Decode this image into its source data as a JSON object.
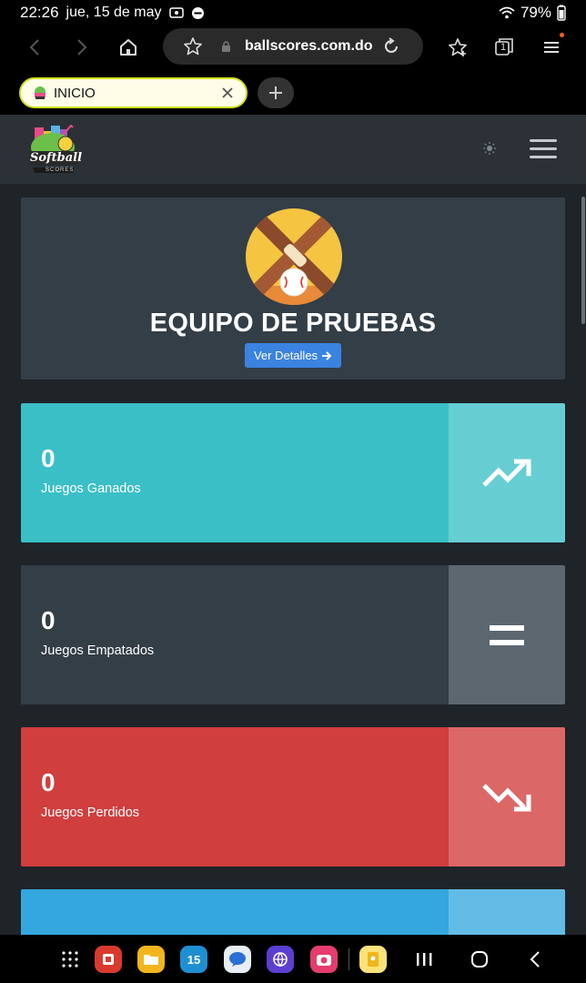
{
  "status_bar": {
    "time": "22:26",
    "date": "jue, 15 de may",
    "battery": "79%",
    "icons": [
      "screen-record-icon",
      "dnd-icon",
      "wifi-icon",
      "battery-icon"
    ]
  },
  "browser": {
    "url": "ballscores.com.do",
    "tab_label": "INICIO",
    "icons": [
      "back-icon",
      "forward-icon",
      "home-icon",
      "bookmark-star-icon",
      "lock-icon",
      "reload-icon",
      "favorites-icon",
      "tabs-icon",
      "menu-icon",
      "close-icon",
      "plus-icon"
    ],
    "tab_count": "1"
  },
  "site": {
    "logo_text": "Softball",
    "logo_subtext": "SCORES",
    "icons": [
      "theme-toggle-icon",
      "hamburger-menu-icon"
    ]
  },
  "team": {
    "name": "EQUIPO DE PRUEBAS",
    "details_label": "Ver Detalles"
  },
  "stats": {
    "won": {
      "value": "0",
      "label": "Juegos Ganados",
      "icon": "trend-up-icon"
    },
    "tied": {
      "value": "0",
      "label": "Juegos Empatados",
      "icon": "equals-icon"
    },
    "lost": {
      "value": "0",
      "label": "Juegos Perdidos",
      "icon": "trend-down-icon"
    }
  },
  "colors": {
    "won": "#3bbfc6",
    "tied": "#343e47",
    "lost": "#d03e3e",
    "next": "#34a7de",
    "button": "#3b83e0",
    "header": "#2b3137"
  },
  "nav_bar": {
    "calendar_day": "15",
    "icons": [
      "app-drawer-icon",
      "app-icon-red",
      "folder-icon",
      "calendar-icon",
      "messages-icon",
      "browser-icon",
      "camera-icon",
      "notes-icon",
      "recents-icon",
      "home-nav-icon",
      "back-nav-icon"
    ]
  }
}
